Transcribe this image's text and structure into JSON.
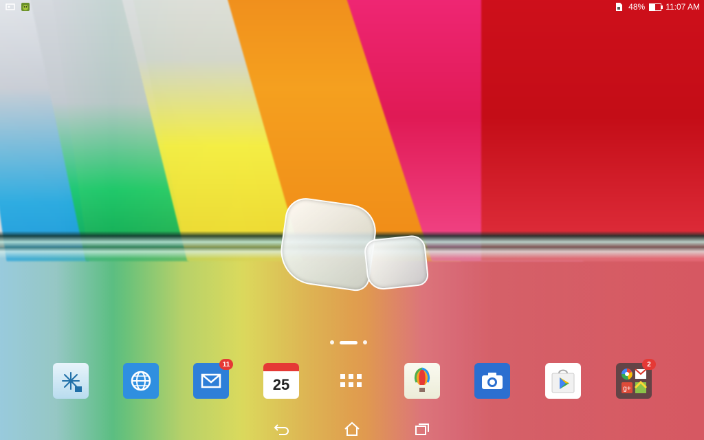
{
  "status_bar": {
    "left_icons": [
      "photo-icon",
      "android-robot-icon"
    ],
    "battery_percent": "48%",
    "battery_level": 0.48,
    "time": "11:07 AM"
  },
  "home": {
    "page_indicator": {
      "pages": 3,
      "current": 2
    }
  },
  "dock": {
    "apps": [
      {
        "name": "snowflake-app",
        "icon": "snowflake-icon"
      },
      {
        "name": "browser",
        "icon": "globe-icon"
      },
      {
        "name": "email",
        "icon": "envelope-icon",
        "badge": "11"
      },
      {
        "name": "calendar",
        "icon": "calendar-icon",
        "date": "25"
      },
      {
        "name": "all-apps",
        "icon": "apps-grid-icon"
      },
      {
        "name": "themes",
        "icon": "balloon-icon"
      },
      {
        "name": "camera",
        "icon": "camera-icon"
      },
      {
        "name": "play-store",
        "icon": "play-store-icon"
      },
      {
        "name": "google-folder",
        "icon": "folder-icon",
        "badge": "2"
      }
    ]
  },
  "nav_bar": {
    "buttons": [
      "back-icon",
      "home-icon",
      "recents-icon"
    ]
  }
}
